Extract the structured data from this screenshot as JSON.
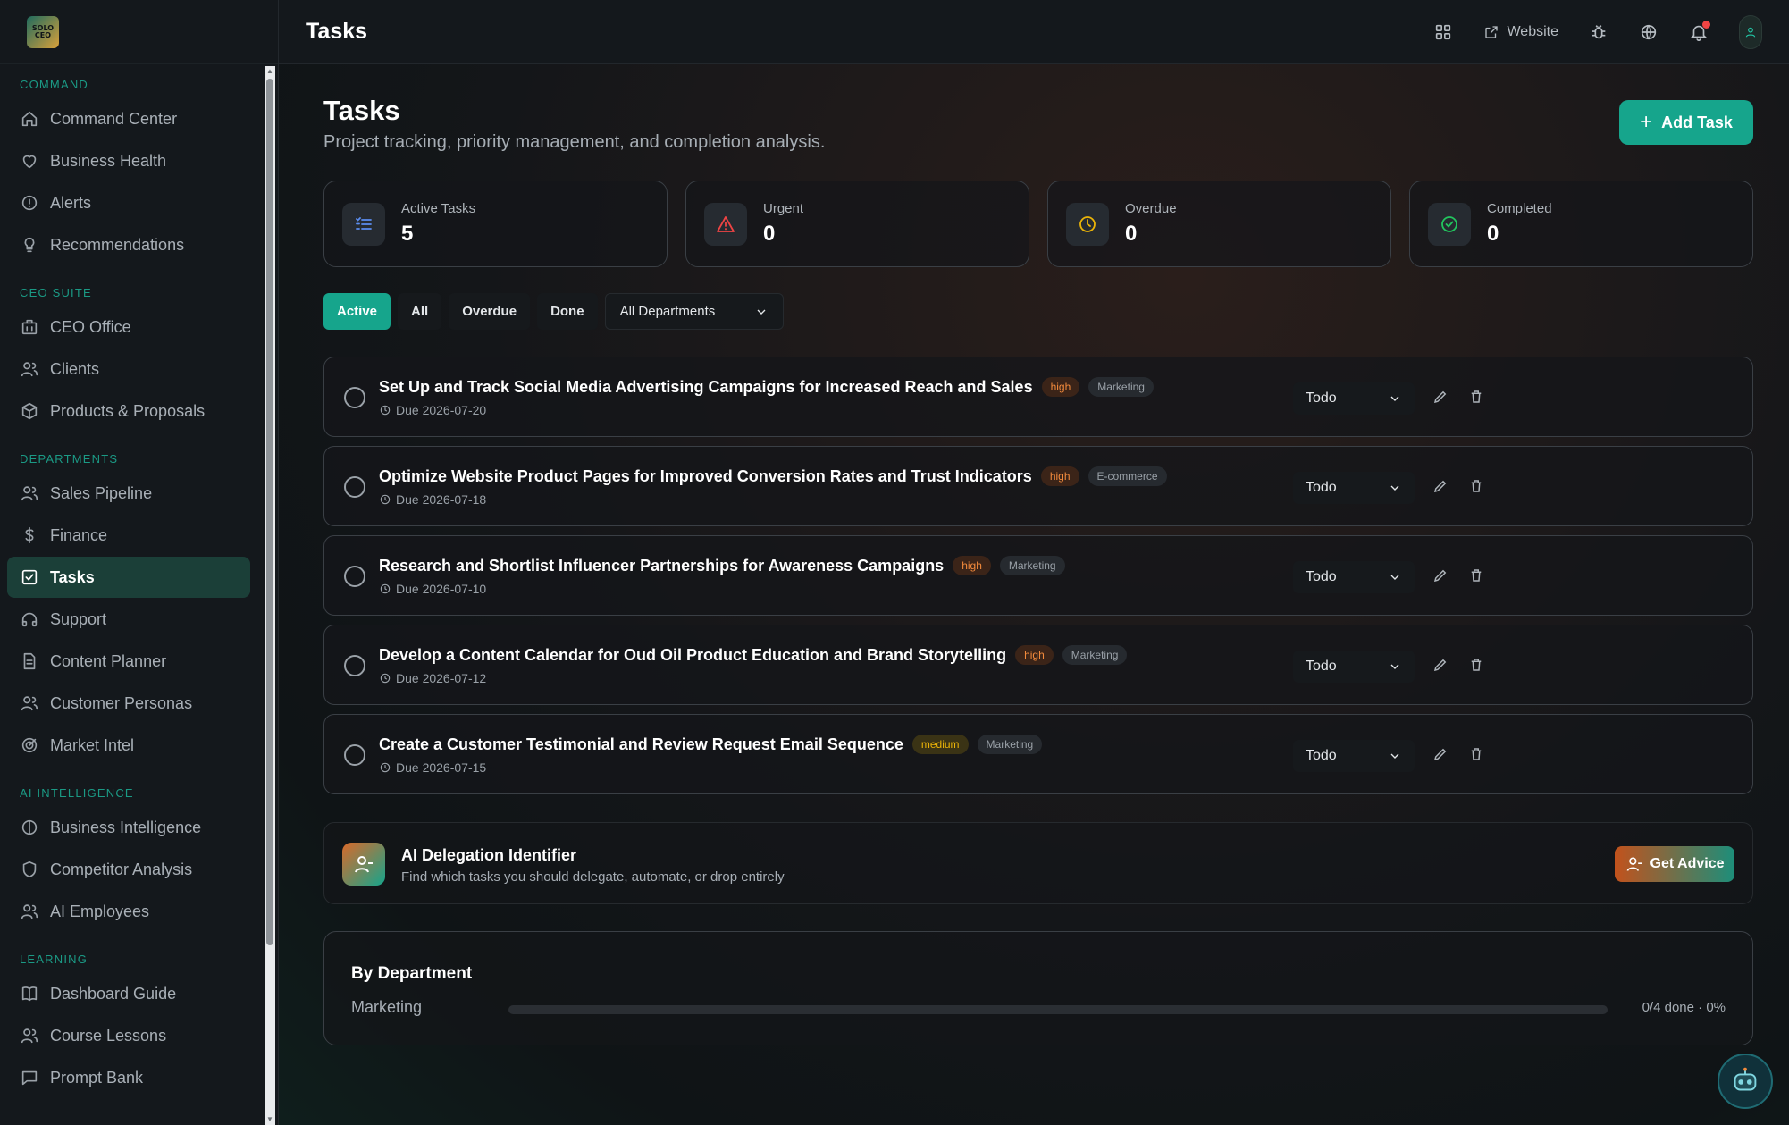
{
  "brand": {
    "logo_text": "SOLO CEO"
  },
  "topbar": {
    "title": "Tasks",
    "website_label": "Website"
  },
  "sidebar": {
    "sections": [
      {
        "label": "COMMAND",
        "items": [
          {
            "label": "Command Center",
            "icon": "home-icon"
          },
          {
            "label": "Business Health",
            "icon": "heart-icon"
          },
          {
            "label": "Alerts",
            "icon": "alert-circle-icon"
          },
          {
            "label": "Recommendations",
            "icon": "lightbulb-icon"
          }
        ]
      },
      {
        "label": "CEO SUITE",
        "items": [
          {
            "label": "CEO Office",
            "icon": "building-icon"
          },
          {
            "label": "Clients",
            "icon": "users-icon"
          },
          {
            "label": "Products & Proposals",
            "icon": "package-icon"
          }
        ]
      },
      {
        "label": "DEPARTMENTS",
        "items": [
          {
            "label": "Sales Pipeline",
            "icon": "users-icon"
          },
          {
            "label": "Finance",
            "icon": "dollar-icon"
          },
          {
            "label": "Tasks",
            "icon": "checkbox-icon",
            "active": true
          },
          {
            "label": "Support",
            "icon": "headphones-icon"
          },
          {
            "label": "Content Planner",
            "icon": "file-icon"
          },
          {
            "label": "Customer Personas",
            "icon": "users-icon"
          },
          {
            "label": "Market Intel",
            "icon": "target-icon"
          }
        ]
      },
      {
        "label": "AI INTELLIGENCE",
        "items": [
          {
            "label": "Business Intelligence",
            "icon": "circle-half-icon"
          },
          {
            "label": "Competitor Analysis",
            "icon": "shield-icon"
          },
          {
            "label": "AI Employees",
            "icon": "users-icon"
          }
        ]
      },
      {
        "label": "LEARNING",
        "items": [
          {
            "label": "Dashboard Guide",
            "icon": "book-icon"
          },
          {
            "label": "Course Lessons",
            "icon": "users-icon"
          },
          {
            "label": "Prompt Bank",
            "icon": "message-icon"
          }
        ]
      }
    ]
  },
  "page": {
    "title": "Tasks",
    "subtitle": "Project tracking, priority management, and completion analysis.",
    "add_task_label": "Add Task"
  },
  "stats": [
    {
      "label": "Active Tasks",
      "value": "5",
      "icon": "list-icon",
      "color": "#5b8def"
    },
    {
      "label": "Urgent",
      "value": "0",
      "icon": "warning-icon",
      "color": "#ef4444"
    },
    {
      "label": "Overdue",
      "value": "0",
      "icon": "clock-icon",
      "color": "#eab308"
    },
    {
      "label": "Completed",
      "value": "0",
      "icon": "check-circle-icon",
      "color": "#22c55e"
    }
  ],
  "filters": {
    "chips": [
      "Active",
      "All",
      "Overdue",
      "Done"
    ],
    "active_chip": "Active",
    "department_select": "All Departments"
  },
  "tasks": [
    {
      "title": "Set Up and Track Social Media Advertising Campaigns for Increased Reach and Sales",
      "priority": "high",
      "department": "Marketing",
      "due": "Due 2026-07-20",
      "status": "Todo"
    },
    {
      "title": "Optimize Website Product Pages for Improved Conversion Rates and Trust Indicators",
      "priority": "high",
      "department": "E-commerce",
      "due": "Due 2026-07-18",
      "status": "Todo"
    },
    {
      "title": "Research and Shortlist Influencer Partnerships for Awareness Campaigns",
      "priority": "high",
      "department": "Marketing",
      "due": "Due 2026-07-10",
      "status": "Todo"
    },
    {
      "title": "Develop a Content Calendar for Oud Oil Product Education and Brand Storytelling",
      "priority": "high",
      "department": "Marketing",
      "due": "Due 2026-07-12",
      "status": "Todo"
    },
    {
      "title": "Create a Customer Testimonial and Review Request Email Sequence",
      "priority": "medium",
      "department": "Marketing",
      "due": "Due 2026-07-15",
      "status": "Todo"
    }
  ],
  "delegation": {
    "title": "AI Delegation Identifier",
    "subtitle": "Find which tasks you should delegate, automate, or drop entirely",
    "button_label": "Get Advice"
  },
  "by_department": {
    "title": "By Department",
    "rows": [
      {
        "name": "Marketing",
        "summary": "0/4 done · 0%",
        "progress": 0
      }
    ]
  },
  "colors": {
    "accent": "#16a58c",
    "high": "#f28a3c",
    "medium": "#eab308"
  }
}
